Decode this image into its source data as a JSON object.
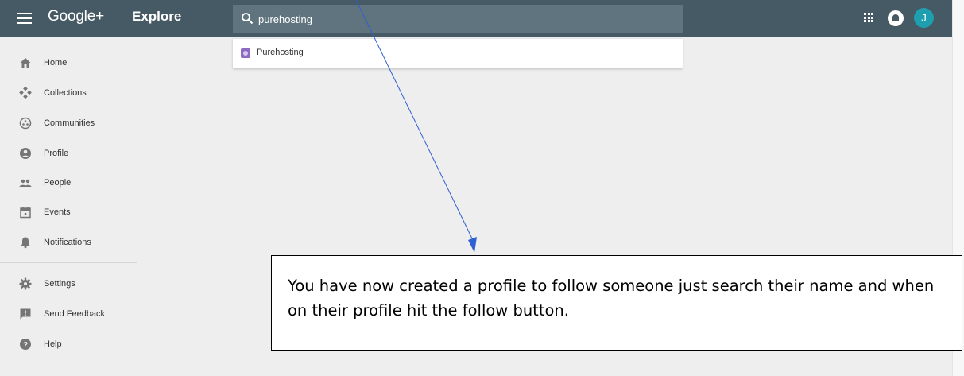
{
  "topbar": {
    "brand": "Google+",
    "section": "Explore",
    "search_value": "purehosting",
    "avatar_letter": "J"
  },
  "dropdown": {
    "suggestions": [
      {
        "label": "Purehosting"
      }
    ]
  },
  "sidebar": {
    "items": [
      {
        "label": "Home",
        "icon": "home-icon"
      },
      {
        "label": "Collections",
        "icon": "collections-icon"
      },
      {
        "label": "Communities",
        "icon": "communities-icon"
      },
      {
        "label": "Profile",
        "icon": "profile-icon"
      },
      {
        "label": "People",
        "icon": "people-icon"
      },
      {
        "label": "Events",
        "icon": "events-icon"
      },
      {
        "label": "Notifications",
        "icon": "bell-icon"
      },
      {
        "label": "Settings",
        "icon": "gear-icon"
      },
      {
        "label": "Send Feedback",
        "icon": "feedback-icon"
      },
      {
        "label": "Help",
        "icon": "help-icon"
      }
    ]
  },
  "annotation": {
    "text": "You have now created a profile to follow someone just search their name and when on their profile hit the follow button."
  },
  "colors": {
    "topbar": "#455a64",
    "search_box": "#5f747e",
    "avatar": "#1e9fb0",
    "background": "#eeeeee",
    "arrow": "#2f5fd0"
  }
}
